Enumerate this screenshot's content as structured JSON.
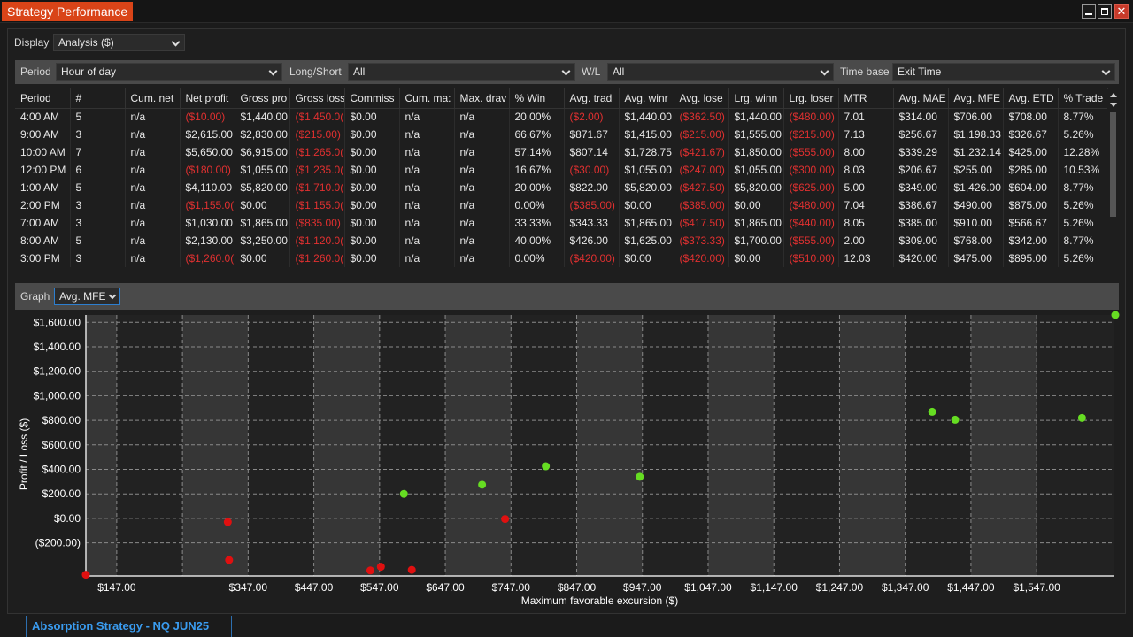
{
  "window": {
    "title": "Strategy Performance"
  },
  "display": {
    "label": "Display",
    "value": "Analysis ($)"
  },
  "filters": {
    "period_label": "Period",
    "period_value": "Hour of day",
    "longshort_label": "Long/Short",
    "longshort_value": "All",
    "wl_label": "W/L",
    "wl_value": "All",
    "timebase_label": "Time base",
    "timebase_value": "Exit Time"
  },
  "table": {
    "columns": [
      "Period",
      "#",
      "Cum. net",
      "Net profit",
      "Gross pro",
      "Gross loss",
      "Commiss",
      "Cum. ma:",
      "Max. drav",
      "% Win",
      "Avg. trad",
      "Avg. winr",
      "Avg. lose",
      "Lrg. winn",
      "Lrg. loser",
      "MTR",
      "Avg. MAE",
      "Avg. MFE",
      "Avg. ETD",
      "% Trade"
    ],
    "rows": [
      [
        "4:00 AM",
        "5",
        "n/a",
        "($10.00)",
        "$1,440.00",
        "($1,450.0(",
        "$0.00",
        "n/a",
        "n/a",
        "20.00%",
        "($2.00)",
        "$1,440.00",
        "($362.50)",
        "$1,440.00",
        "($480.00)",
        "7.01",
        "$314.00",
        "$706.00",
        "$708.00",
        "8.77%"
      ],
      [
        "9:00 AM",
        "3",
        "n/a",
        "$2,615.00",
        "$2,830.00",
        "($215.00)",
        "$0.00",
        "n/a",
        "n/a",
        "66.67%",
        "$871.67",
        "$1,415.00",
        "($215.00)",
        "$1,555.00",
        "($215.00)",
        "7.13",
        "$256.67",
        "$1,198.33",
        "$326.67",
        "5.26%"
      ],
      [
        "10:00 AM",
        "7",
        "n/a",
        "$5,650.00",
        "$6,915.00",
        "($1,265.0(",
        "$0.00",
        "n/a",
        "n/a",
        "57.14%",
        "$807.14",
        "$1,728.75",
        "($421.67)",
        "$1,850.00",
        "($555.00)",
        "8.00",
        "$339.29",
        "$1,232.14",
        "$425.00",
        "12.28%"
      ],
      [
        "12:00 PM",
        "6",
        "n/a",
        "($180.00)",
        "$1,055.00",
        "($1,235.0(",
        "$0.00",
        "n/a",
        "n/a",
        "16.67%",
        "($30.00)",
        "$1,055.00",
        "($247.00)",
        "$1,055.00",
        "($300.00)",
        "8.03",
        "$206.67",
        "$255.00",
        "$285.00",
        "10.53%"
      ],
      [
        "1:00 AM",
        "5",
        "n/a",
        "$4,110.00",
        "$5,820.00",
        "($1,710.0(",
        "$0.00",
        "n/a",
        "n/a",
        "20.00%",
        "$822.00",
        "$5,820.00",
        "($427.50)",
        "$5,820.00",
        "($625.00)",
        "5.00",
        "$349.00",
        "$1,426.00",
        "$604.00",
        "8.77%"
      ],
      [
        "2:00 PM",
        "3",
        "n/a",
        "($1,155.0(",
        "$0.00",
        "($1,155.0(",
        "$0.00",
        "n/a",
        "n/a",
        "0.00%",
        "($385.00)",
        "$0.00",
        "($385.00)",
        "$0.00",
        "($480.00)",
        "7.04",
        "$386.67",
        "$490.00",
        "$875.00",
        "5.26%"
      ],
      [
        "7:00 AM",
        "3",
        "n/a",
        "$1,030.00",
        "$1,865.00",
        "($835.00)",
        "$0.00",
        "n/a",
        "n/a",
        "33.33%",
        "$343.33",
        "$1,865.00",
        "($417.50)",
        "$1,865.00",
        "($440.00)",
        "8.05",
        "$385.00",
        "$910.00",
        "$566.67",
        "5.26%"
      ],
      [
        "8:00 AM",
        "5",
        "n/a",
        "$2,130.00",
        "$3,250.00",
        "($1,120.0(",
        "$0.00",
        "n/a",
        "n/a",
        "40.00%",
        "$426.00",
        "$1,625.00",
        "($373.33)",
        "$1,700.00",
        "($555.00)",
        "2.00",
        "$309.00",
        "$768.00",
        "$342.00",
        "8.77%"
      ],
      [
        "3:00 PM",
        "3",
        "n/a",
        "($1,260.0(",
        "$0.00",
        "($1,260.0(",
        "$0.00",
        "n/a",
        "n/a",
        "0.00%",
        "($420.00)",
        "$0.00",
        "($420.00)",
        "$0.00",
        "($510.00)",
        "12.03",
        "$420.00",
        "$475.00",
        "$895.00",
        "5.26%"
      ]
    ]
  },
  "graph": {
    "label": "Graph",
    "value": "Avg. MFE"
  },
  "chart_data": {
    "type": "scatter",
    "xlabel": "Maximum favorable excursion ($)",
    "ylabel": "Profit / Loss ($)",
    "x_ticks": [
      "$147.00",
      "$347.00",
      "$447.00",
      "$547.00",
      "$647.00",
      "$747.00",
      "$847.00",
      "$947.00",
      "$1,047.00",
      "$1,147.00",
      "$1,247.00",
      "$1,347.00",
      "$1,447.00",
      "$1,547.00"
    ],
    "y_ticks": [
      "$1,600.00",
      "$1,400.00",
      "$1,200.00",
      "$1,000.00",
      "$800.00",
      "$600.00",
      "$400.00",
      "$200.00",
      "$0.00",
      "($200.00)"
    ],
    "xlim": [
      100,
      1664
    ],
    "ylim": [
      -470,
      1660
    ],
    "points": [
      {
        "x": 100,
        "y": -460,
        "color": "#e01010"
      },
      {
        "x": 316,
        "y": -30,
        "color": "#e01010"
      },
      {
        "x": 318,
        "y": -340,
        "color": "#e01010"
      },
      {
        "x": 533,
        "y": -425,
        "color": "#e01010"
      },
      {
        "x": 549,
        "y": -395,
        "color": "#e01010"
      },
      {
        "x": 596,
        "y": -420,
        "color": "#e01010"
      },
      {
        "x": 584,
        "y": 200,
        "color": "#66dd22"
      },
      {
        "x": 703,
        "y": 275,
        "color": "#66dd22"
      },
      {
        "x": 738,
        "y": -5,
        "color": "#e01010"
      },
      {
        "x": 800,
        "y": 425,
        "color": "#66dd22"
      },
      {
        "x": 943,
        "y": 340,
        "color": "#66dd22"
      },
      {
        "x": 1388,
        "y": 870,
        "color": "#66dd22"
      },
      {
        "x": 1423,
        "y": 805,
        "color": "#66dd22"
      },
      {
        "x": 1616,
        "y": 820,
        "color": "#66dd22"
      },
      {
        "x": 1860,
        "y": 1665,
        "color": "#66dd22"
      }
    ],
    "grid": true
  },
  "bottom_tab": {
    "label": "Absorption Strategy - NQ JUN25"
  }
}
